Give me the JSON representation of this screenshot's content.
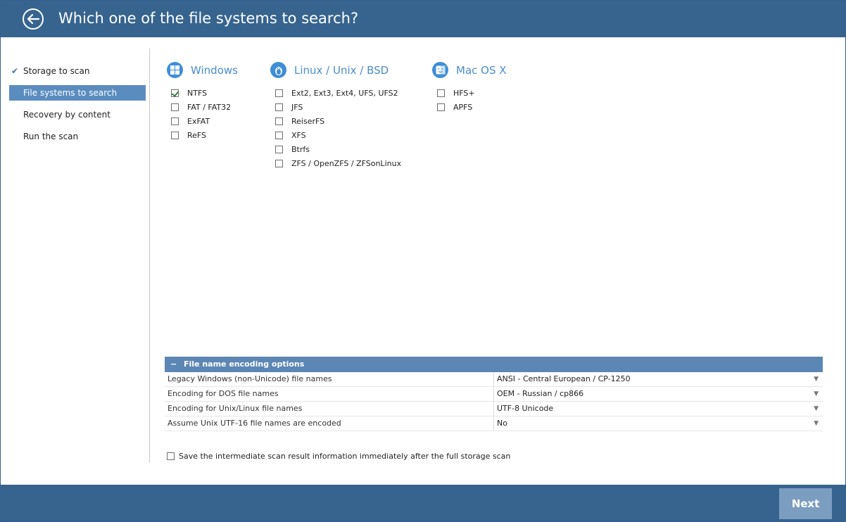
{
  "header": {
    "title": "Which one of the file systems to search?"
  },
  "sidebar": {
    "items": [
      {
        "label": "Storage to scan",
        "state": "done"
      },
      {
        "label": "File systems to search",
        "state": "active"
      },
      {
        "label": "Recovery by content",
        "state": "pending"
      },
      {
        "label": "Run the scan",
        "state": "pending"
      }
    ]
  },
  "filesystems": {
    "windows": {
      "title": "Windows",
      "icon": "windows-icon",
      "items": [
        {
          "label": "NTFS",
          "checked": true
        },
        {
          "label": "FAT / FAT32",
          "checked": false
        },
        {
          "label": "ExFAT",
          "checked": false
        },
        {
          "label": "ReFS",
          "checked": false
        }
      ]
    },
    "linux": {
      "title": "Linux / Unix / BSD",
      "icon": "linux-penguin-icon",
      "items": [
        {
          "label": "Ext2, Ext3, Ext4, UFS, UFS2",
          "checked": false
        },
        {
          "label": "JFS",
          "checked": false
        },
        {
          "label": "ReiserFS",
          "checked": false
        },
        {
          "label": "XFS",
          "checked": false
        },
        {
          "label": "Btrfs",
          "checked": false
        },
        {
          "label": "ZFS / OpenZFS / ZFSonLinux",
          "checked": false
        }
      ]
    },
    "mac": {
      "title": "Mac OS X",
      "icon": "mac-finder-icon",
      "items": [
        {
          "label": "HFS+",
          "checked": false
        },
        {
          "label": "APFS",
          "checked": false
        }
      ]
    }
  },
  "encoding": {
    "toggle": "−",
    "title": "File name encoding options",
    "rows": [
      {
        "label": "Legacy Windows (non-Unicode) file names",
        "value": "ANSI - Central European / CP-1250"
      },
      {
        "label": "Encoding for DOS file names",
        "value": "OEM - Russian / cp866"
      },
      {
        "label": "Encoding for Unix/Linux file names",
        "value": "UTF-8 Unicode"
      },
      {
        "label": "Assume Unix UTF-16 file names are encoded",
        "value": "No"
      }
    ]
  },
  "save_option": {
    "label": "Save the intermediate scan result information immediately after the full storage scan",
    "checked": false
  },
  "footer": {
    "next_label": "Next"
  },
  "colors": {
    "header_bg": "#36648f",
    "active_item": "#5b8cc0",
    "accent": "#4a8cc9",
    "next_button": "#7b9dbf"
  }
}
